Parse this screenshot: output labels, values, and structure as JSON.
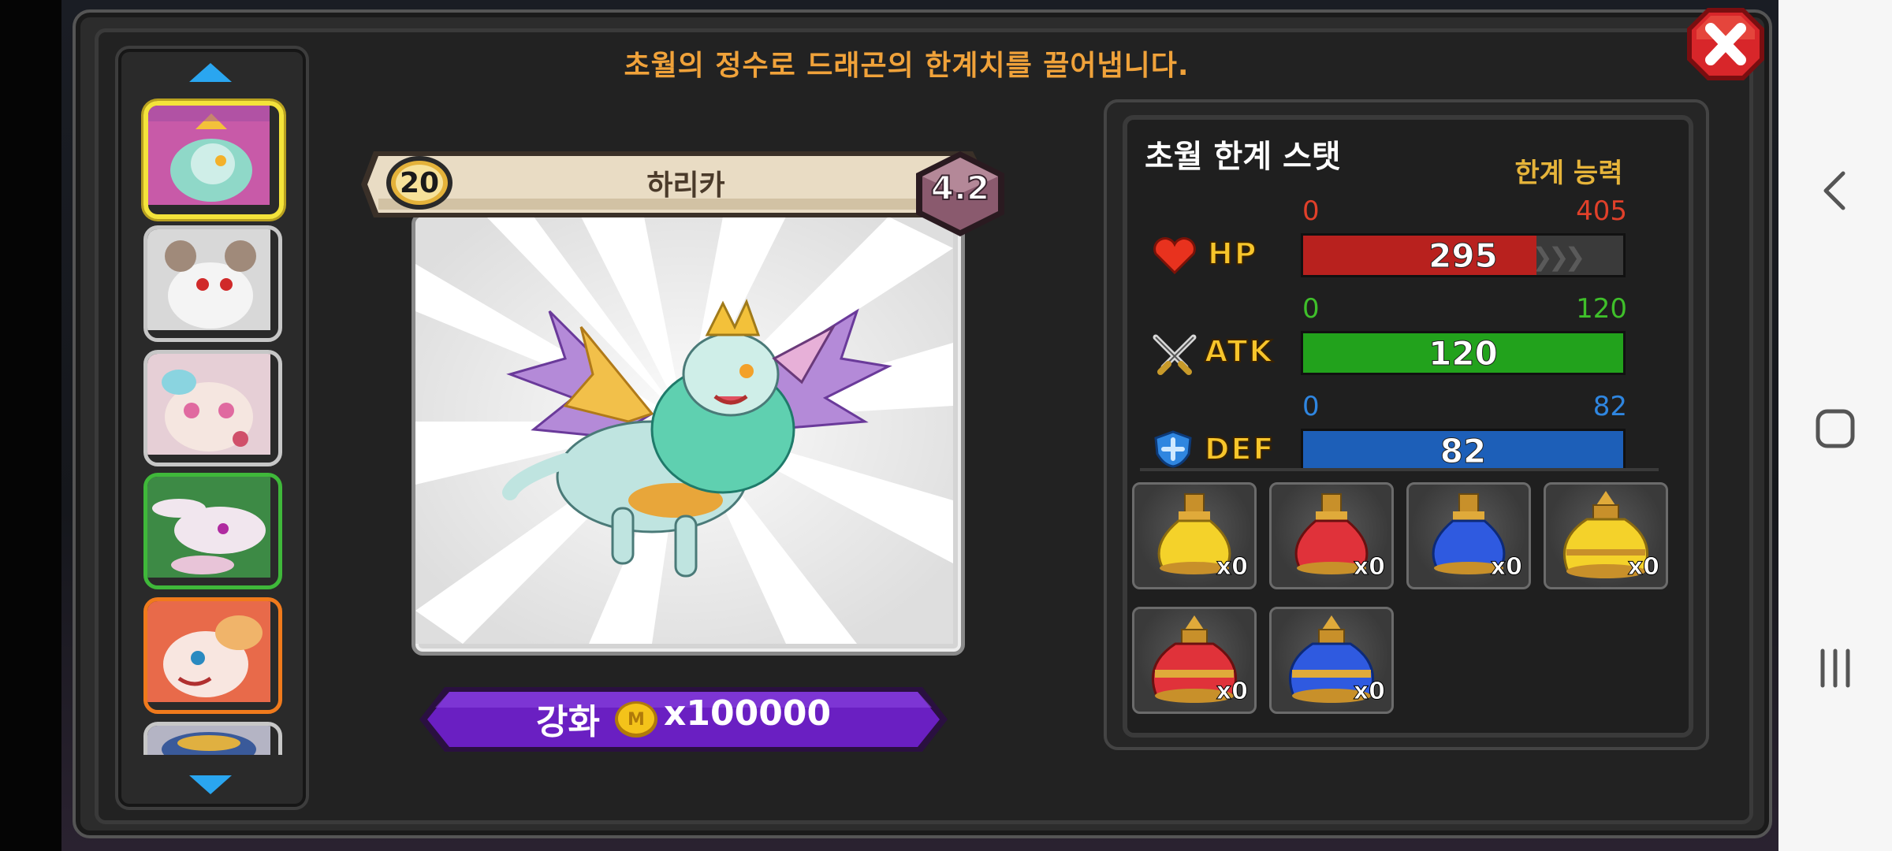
{
  "banner": "초월의 정수로 드래곤의 한계치를 끌어냅니다.",
  "dragon": {
    "level": "20",
    "name": "하리카",
    "grade": "4.2"
  },
  "enhance": {
    "label": "강화",
    "cost": "x100000",
    "coin_symbol": "M"
  },
  "stats_panel": {
    "title": "초월 한계 스탯",
    "limit_title": "한계 능력",
    "stats": [
      {
        "key": "hp",
        "label": "HP",
        "min": "0",
        "max": "405",
        "value": "295",
        "fraction": 0.728,
        "color": "#b8211e",
        "min_color": "#e0402a",
        "max_color": "#e0402a"
      },
      {
        "key": "atk",
        "label": "ATK",
        "min": "0",
        "max": "120",
        "value": "120",
        "fraction": 1.0,
        "color": "#22a21c",
        "min_color": "#3fbf2a",
        "max_color": "#3fbf2a"
      },
      {
        "key": "def",
        "label": "DEF",
        "min": "0",
        "max": "82",
        "value": "82",
        "fraction": 1.0,
        "color": "#1d5fb8",
        "min_color": "#2f86e0",
        "max_color": "#2f86e0"
      }
    ]
  },
  "items": [
    {
      "name": "yellow-potion-small",
      "qty": "x0"
    },
    {
      "name": "red-potion-small",
      "qty": "x0"
    },
    {
      "name": "blue-potion-small",
      "qty": "x0"
    },
    {
      "name": "yellow-potion-large",
      "qty": "x0"
    },
    {
      "name": "red-potion-large",
      "qty": "x0"
    },
    {
      "name": "blue-potion-large",
      "qty": "x0"
    }
  ],
  "dragon_list": [
    {
      "name": "harika",
      "selected": true,
      "border": "#f4e33a",
      "bg": "#c85aa8"
    },
    {
      "name": "white-horned-dragon",
      "selected": false,
      "border": "#c7c7c7",
      "bg": "#dcdcdc"
    },
    {
      "name": "pastel-dragon",
      "selected": false,
      "border": "#c7c7c7",
      "bg": "#e6cfd6"
    },
    {
      "name": "green-rabbit-dragon",
      "selected": false,
      "border": "#3fb83a",
      "bg": "#3d8a45"
    },
    {
      "name": "orange-dragon",
      "selected": false,
      "border": "#f07a1c",
      "bg": "#e86a4a"
    },
    {
      "name": "partial-dragon",
      "selected": false,
      "border": "#c7c7c7",
      "bg": "#b4b4c4"
    }
  ],
  "colors": {
    "banner": "#f0a23a",
    "limit_title": "#e6b43a",
    "enhance_button": "#6a1fc2",
    "close_button": "#d8262a"
  },
  "icons": [
    "close-icon",
    "up-arrow-icon",
    "down-arrow-icon",
    "heart-icon",
    "crossed-swords-icon",
    "shield-icon",
    "coin-icon",
    "back-nav-icon",
    "home-nav-icon",
    "recents-nav-icon"
  ]
}
